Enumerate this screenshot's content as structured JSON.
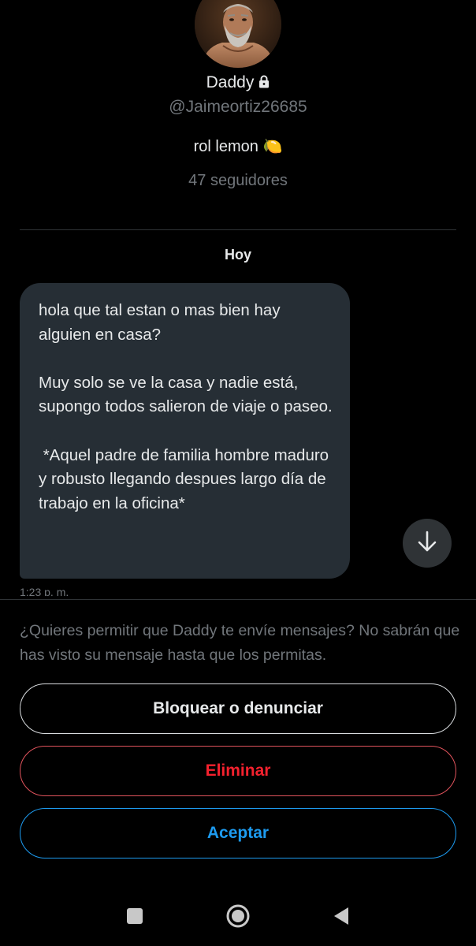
{
  "profile": {
    "name": "Daddy",
    "handle": "@Jaimeortiz26685",
    "bio": "rol lemon 🍋",
    "followers": "47 seguidores"
  },
  "conversation": {
    "date_label": "Hoy",
    "messages": [
      {
        "text": "hola que tal estan o mas bien hay alguien en casa?\n\nMuy solo se ve la casa y nadie está, supongo todos salieron de viaje o paseo.\n\n *Aquel padre de familia hombre maduro y robusto llegando despues largo día de trabajo en la oficina*",
        "time": "1:23 p. m."
      }
    ]
  },
  "request": {
    "text": "¿Quieres permitir que Daddy te envíe mensajes? No sabrán que has visto su mensaje hasta que los permitas.",
    "block_label": "Bloquear o denunciar",
    "delete_label": "Eliminar",
    "accept_label": "Aceptar"
  },
  "icons": {
    "lock": "lock-icon",
    "scroll_down": "arrow-down-icon",
    "nav_recents": "square-icon",
    "nav_home": "circle-icon",
    "nav_back": "triangle-back-icon"
  },
  "colors": {
    "background": "#000000",
    "bubble": "#262e35",
    "text": "#e7e9ea",
    "muted": "#71767b",
    "danger": "#f4212e",
    "accent": "#1d9bf0"
  }
}
